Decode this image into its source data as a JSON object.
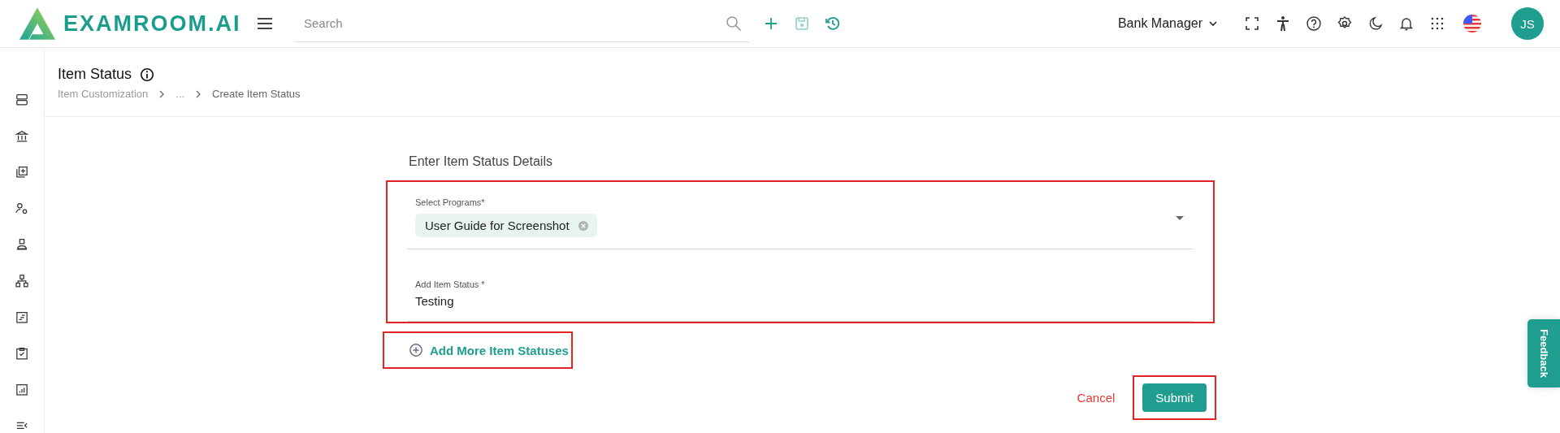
{
  "header": {
    "logo": "EXAMROOM.AI",
    "search": {
      "placeholder": "Search"
    },
    "role": "Bank Manager",
    "avatar": "JS"
  },
  "page": {
    "title": "Item Status",
    "breadcrumb": [
      "Item Customization",
      "...",
      "Create Item Status"
    ]
  },
  "form": {
    "heading": "Enter Item Status Details",
    "programs": {
      "label": "Select Programs*",
      "chips": [
        "User Guide for Screenshot"
      ]
    },
    "status": {
      "label": "Add Item Status *",
      "value": "Testing"
    },
    "add_more": "Add More Item Statuses",
    "buttons": {
      "cancel": "Cancel",
      "submit": "Submit"
    }
  },
  "feedback": "Feedback"
}
